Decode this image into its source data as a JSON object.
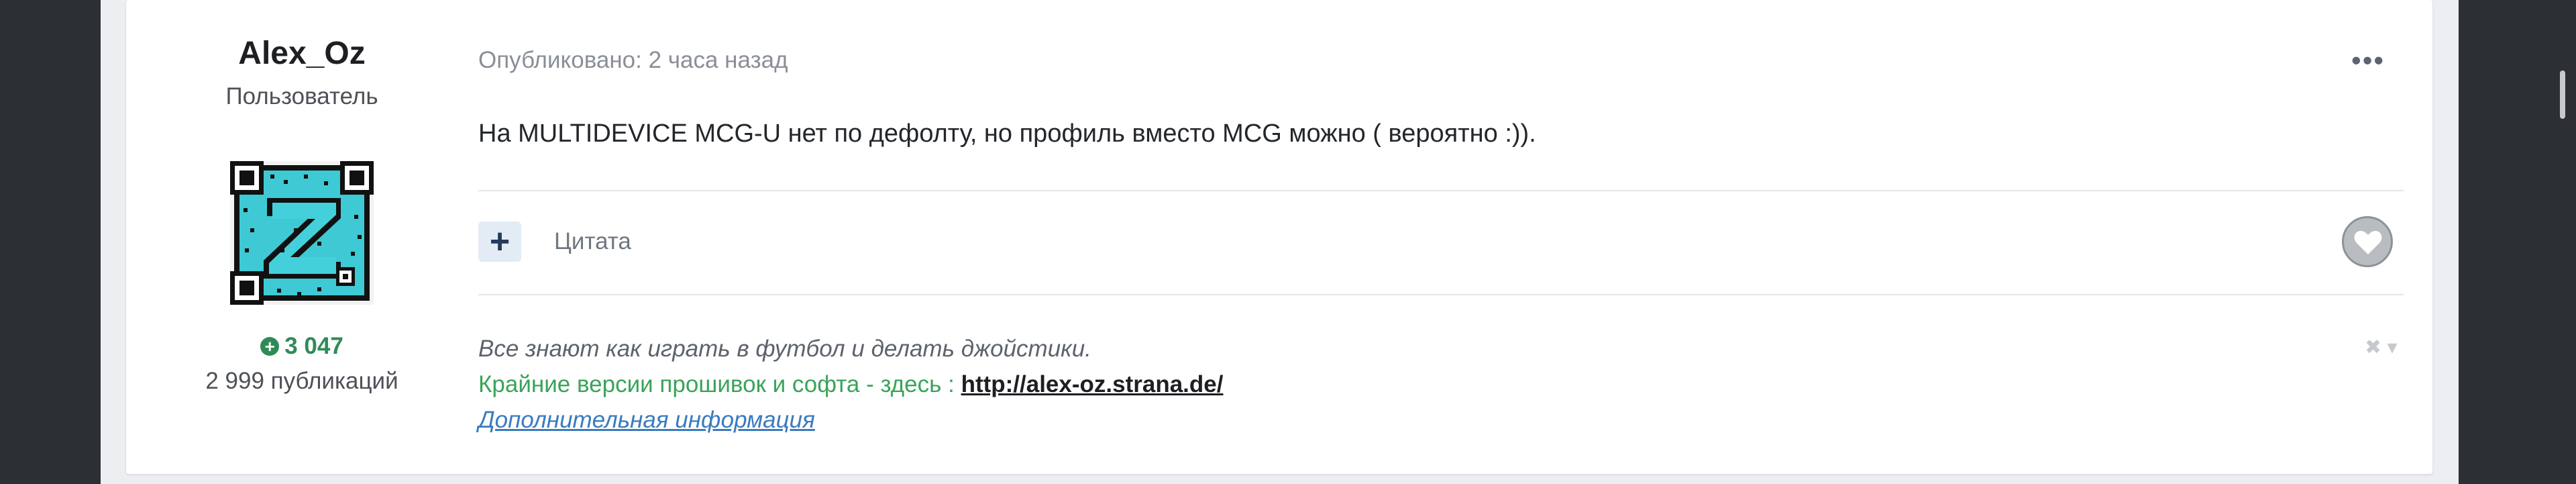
{
  "author": {
    "name": "Alex_Oz",
    "role": "Пользователь",
    "reputation": "3 047",
    "post_count": "2 999 публикаций"
  },
  "post": {
    "meta": "Опубликовано: 2 часа назад",
    "more_icon": "•••",
    "content": "На MULTIDEVICE MCG-U нет по дефолту, но профиль вместо MCG можно ( вероятно :)).",
    "quote_icon": "+",
    "quote_label": "Цитата"
  },
  "signature": {
    "line1": "Все знают как играть в футбол и делать джойстики.",
    "line2_text": "Крайние версии прошивок и софта - здесь : ",
    "line2_link": "http://alex-oz.strana.de/",
    "more_info": "Дополнительная информация",
    "controls": "✖ ▾"
  },
  "colors": {
    "accent_green": "#2e8b57",
    "link_blue": "#3a7bbf",
    "background_dark": "#2c2f33"
  }
}
